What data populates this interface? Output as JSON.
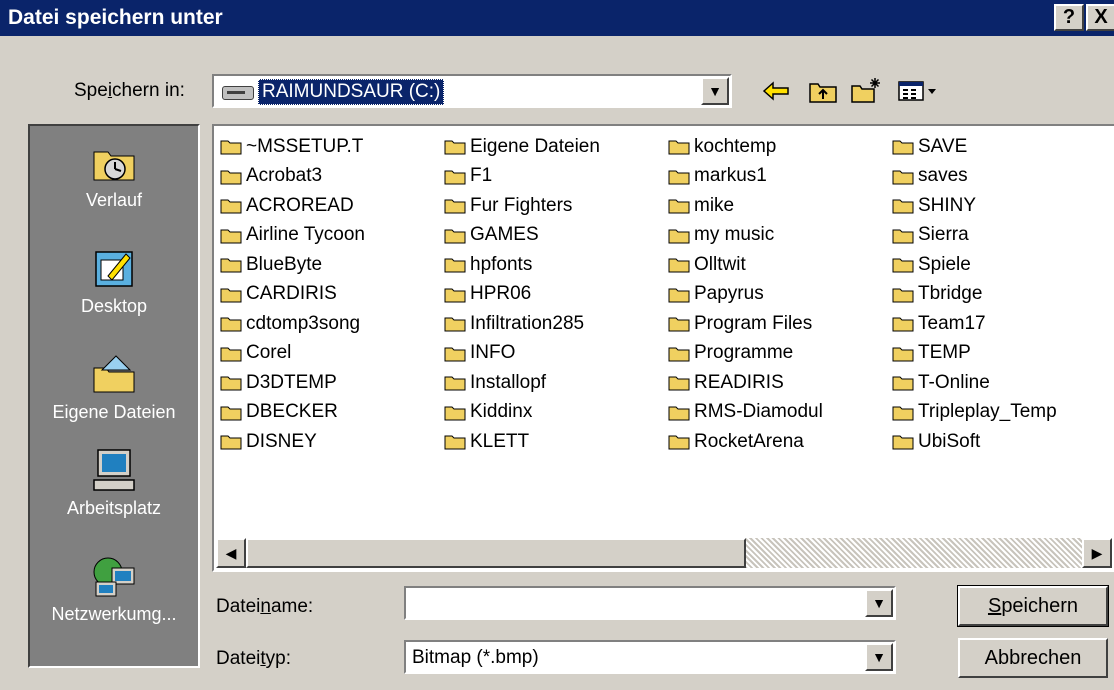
{
  "window": {
    "title": "Datei speichern unter",
    "help_label": "?",
    "close_label": "X"
  },
  "save_in": {
    "label_pre": "Spe",
    "label_accel": "i",
    "label_post": "chern in:",
    "value": "RAIMUNDSAUR (C:)"
  },
  "toolbar": {
    "back_icon": "back-arrow-icon",
    "up_icon": "folder-up-icon",
    "new_folder_icon": "new-folder-icon",
    "view_icon": "view-menu-icon"
  },
  "places": [
    {
      "label": "Verlauf",
      "icon": "history-icon"
    },
    {
      "label": "Desktop",
      "icon": "desktop-icon"
    },
    {
      "label": "Eigene Dateien",
      "icon": "my-documents-icon"
    },
    {
      "label": "Arbeitsplatz",
      "icon": "my-computer-icon"
    },
    {
      "label": "Netzwerkumg...",
      "icon": "network-icon"
    }
  ],
  "files": [
    "~MSSETUP.T",
    "Eigene Dateien",
    "kochtemp",
    "SAVE",
    "Acrobat3",
    "F1",
    "markus1",
    "saves",
    "ACROREAD",
    "Fur Fighters",
    "mike",
    "SHINY",
    "Airline Tycoon",
    "GAMES",
    "my music",
    "Sierra",
    "BlueByte",
    "hpfonts",
    "Olltwit",
    "Spiele",
    "CARDIRIS",
    "HPR06",
    "Papyrus",
    "Tbridge",
    "cdtomp3song",
    "Infiltration285",
    "Program Files",
    "Team17",
    "Corel",
    "INFO",
    "Programme",
    "TEMP",
    "D3DTEMP",
    "Installopf",
    "READIRIS",
    "T-Online",
    "DBECKER",
    "Kiddinx",
    "RMS-Diamodul",
    "Tripleplay_Temp",
    "DISNEY",
    "KLETT",
    "RocketArena",
    "UbiSoft"
  ],
  "filename": {
    "label_pre": "Datei",
    "label_accel": "n",
    "label_post": "ame:",
    "value": ""
  },
  "filetype": {
    "label_pre": "Datei",
    "label_accel": "t",
    "label_post": "yp:",
    "value": "Bitmap (*.bmp)"
  },
  "buttons": {
    "save_accel": "S",
    "save_rest": "peichern",
    "cancel": "Abbrechen"
  },
  "colors": {
    "titlebar": "#0a246a",
    "dialog_bg": "#d4d0c8",
    "places_bg": "#808080",
    "folder": "#f0d060"
  }
}
